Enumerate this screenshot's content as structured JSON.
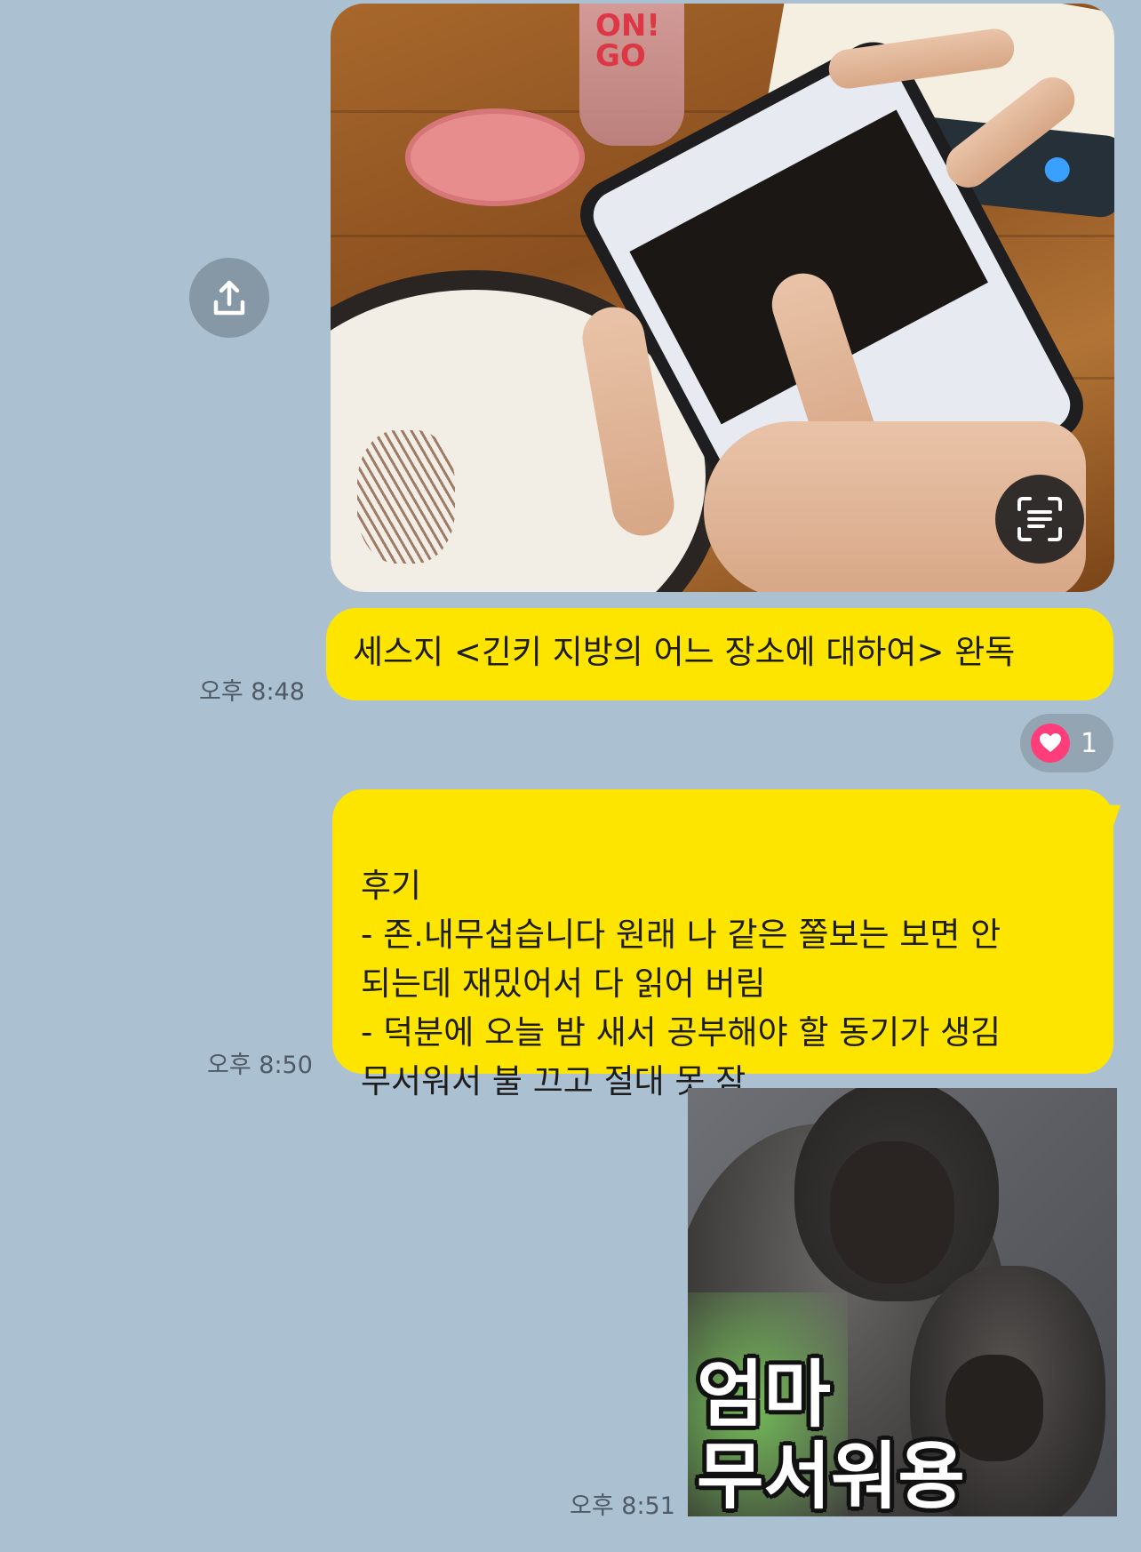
{
  "chat": {
    "messages": [
      {
        "type": "photo",
        "actions": {
          "share_icon": "share-upload-icon",
          "text_scan_icon": "text-scan-icon"
        }
      },
      {
        "type": "text",
        "text": "세스지 <긴키 지방의 어느 장소에 대하여> 완독",
        "time": "오후 8:48",
        "reaction": {
          "icon": "heart-icon",
          "count": "1"
        }
      },
      {
        "type": "text",
        "text": "후기\n- 존.내무섭습니다 원래 나 같은 쫄보는 보면 안\n되는데 재밌어서 다 읽어 버림\n- 덕분에 오늘 밤 새서 공부해야 할 동기가 생김\n무서워서 불 끄고 절대 못 잠",
        "time": "오후 8:50"
      },
      {
        "type": "sticker",
        "caption": "엄마\n무서워용",
        "time": "오후 8:51"
      }
    ]
  },
  "photo_contents": {
    "cup_text": "ON!\nGO"
  },
  "colors": {
    "background": "#abc1d1",
    "my_bubble": "#fee500",
    "reaction_heart": "#ff3d7a",
    "timestamp": "#4e5a66"
  }
}
